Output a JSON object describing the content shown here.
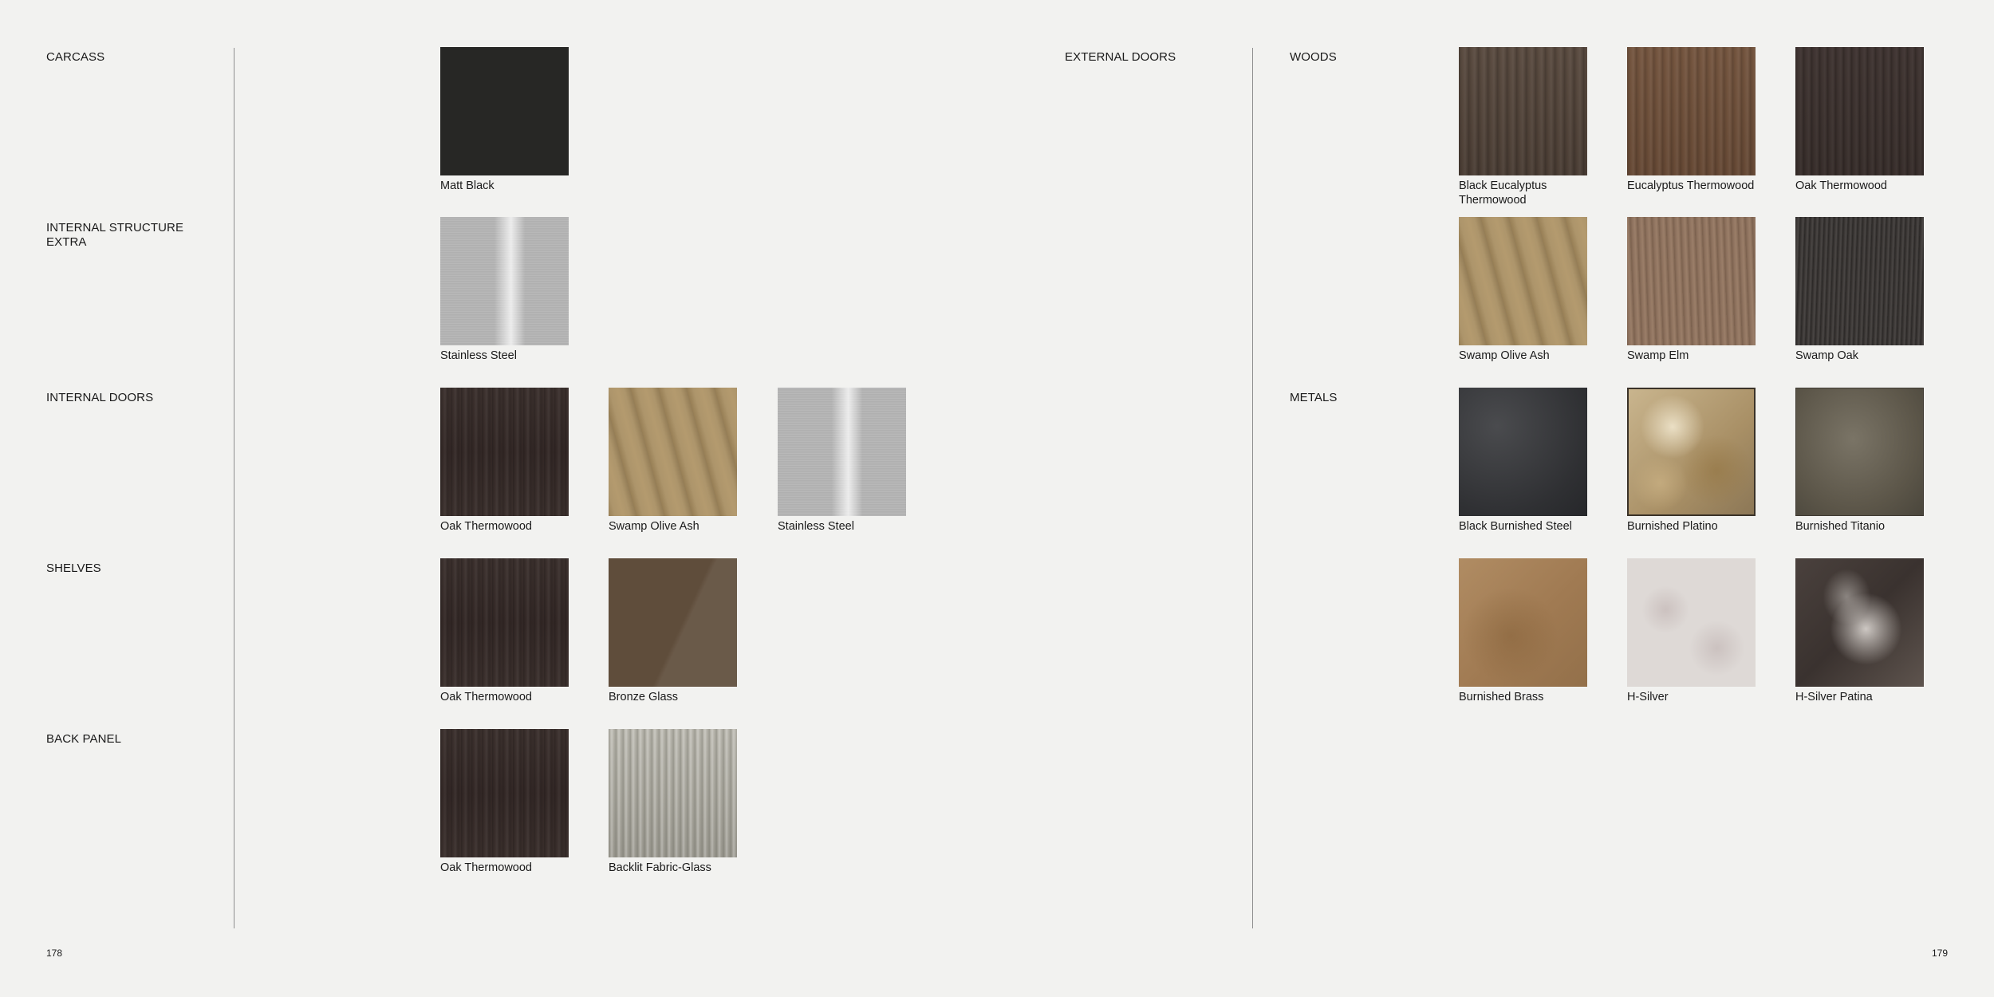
{
  "left_page": {
    "page_number": "178",
    "sections": [
      {
        "title": "CARCASS",
        "swatches": [
          {
            "label": "Matt Black",
            "texture": "matt-black"
          }
        ]
      },
      {
        "title": "INTERNAL STRUCTURE\nEXTRA",
        "swatches": [
          {
            "label": "Stainless Steel",
            "texture": "steel"
          }
        ]
      },
      {
        "title": "INTERNAL DOORS",
        "swatches": [
          {
            "label": "Oak Thermowood",
            "texture": "oak-thermo"
          },
          {
            "label": "Swamp Olive Ash",
            "texture": "olive-ash"
          },
          {
            "label": "Stainless Steel",
            "texture": "steel"
          }
        ]
      },
      {
        "title": "SHELVES",
        "swatches": [
          {
            "label": "Oak Thermowood",
            "texture": "oak-thermo"
          },
          {
            "label": "Bronze Glass",
            "texture": "bronze-glass"
          }
        ]
      },
      {
        "title": "BACK PANEL",
        "swatches": [
          {
            "label": "Oak Thermowood",
            "texture": "oak-thermo"
          },
          {
            "label": "Backlit Fabric-Glass",
            "texture": "backlit"
          }
        ]
      }
    ],
    "column_heading": "EXTERNAL DOORS"
  },
  "right_page": {
    "page_number": "179",
    "woods_title": "WOODS",
    "woods": [
      {
        "label": "Black Eucalyptus Thermowood",
        "texture": "black-euc"
      },
      {
        "label": "Eucalyptus Thermowood",
        "texture": "euc-thermo"
      },
      {
        "label": "Oak Thermowood",
        "texture": "oak-thermo-dark"
      },
      {
        "label": "Swamp Olive Ash",
        "texture": "olive-ash"
      },
      {
        "label": "Swamp Elm",
        "texture": "swamp-elm"
      },
      {
        "label": "Swamp Oak",
        "texture": "swamp-oak"
      }
    ],
    "metals_title": "METALS",
    "metals": [
      {
        "label": "Black Burnished Steel",
        "texture": "black-burnished"
      },
      {
        "label": "Burnished Platino",
        "texture": "burnished-platino"
      },
      {
        "label": "Burnished Titanio",
        "texture": "burnished-titanio"
      },
      {
        "label": "Burnished Brass",
        "texture": "burnished-brass"
      },
      {
        "label": "H-Silver",
        "texture": "h-silver"
      },
      {
        "label": "H-Silver Patina",
        "texture": "h-silver-patina"
      }
    ]
  },
  "colors": {
    "background": "#f2f2f0",
    "text": "#1a1a1a",
    "rule": "#8f8f8f"
  }
}
